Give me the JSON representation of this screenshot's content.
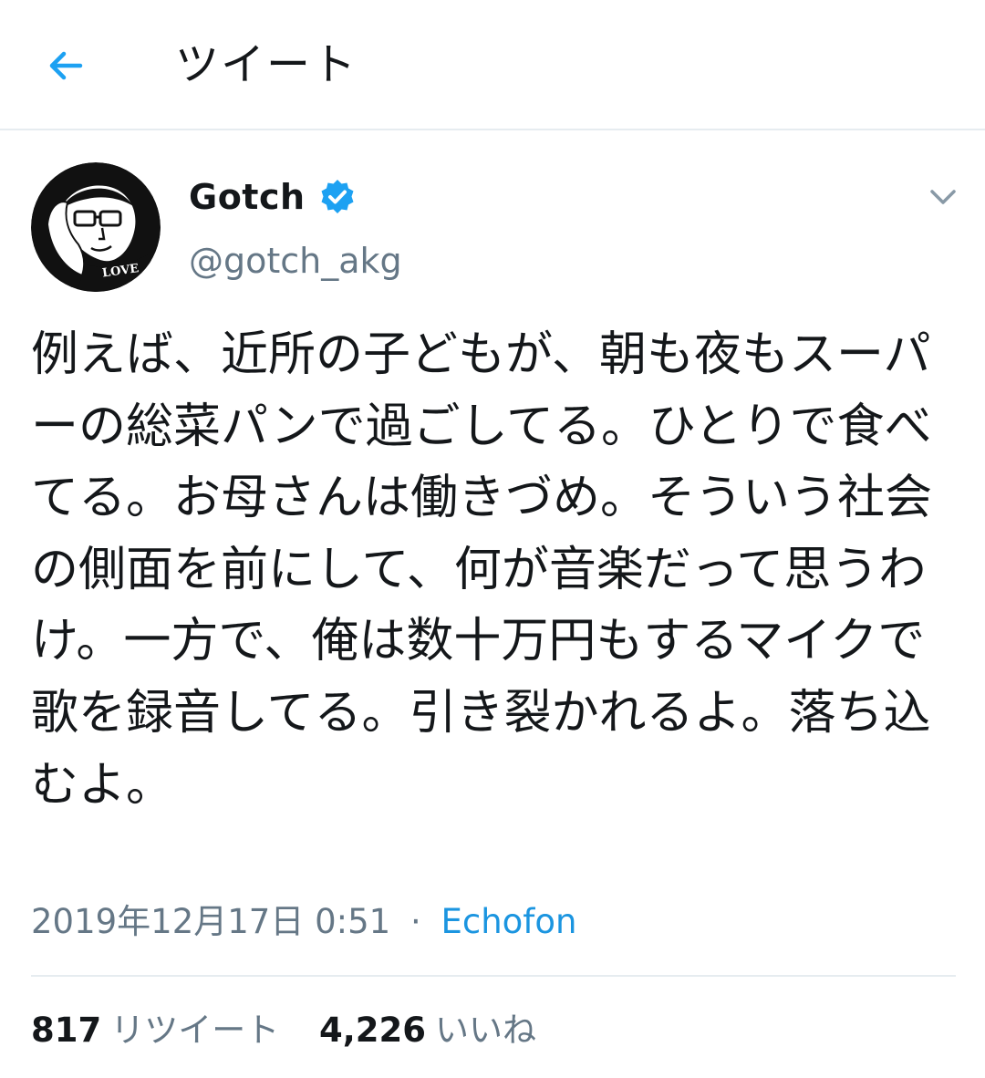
{
  "header": {
    "title": "ツイート",
    "back_icon": "arrow-left-icon"
  },
  "author": {
    "display_name": "Gotch",
    "handle": "@gotch_akg",
    "verified": true,
    "avatar_text": "LOVE"
  },
  "tweet": {
    "text": "例えば、近所の子どもが、朝も夜もスーパーの総菜パンで過ごしてる。ひとりで食べてる。お母さんは働きづめ。そういう社会の側面を前にして、何が音楽だって思うわけ。一方で、俺は数十万円もするマイクで歌を録音してる。引き裂かれるよ。落ち込むよ。",
    "timestamp": "2019年12月17日 0:51",
    "separator": "·",
    "source": "Echofon"
  },
  "stats": {
    "retweets_count": "817",
    "retweets_label": "リツイート",
    "likes_count": "4,226",
    "likes_label": "いいね"
  },
  "colors": {
    "accent": "#1b95e0",
    "text_primary": "#14171a",
    "text_secondary": "#657786",
    "divider": "#e6ecf0",
    "background": "#ffffff"
  }
}
